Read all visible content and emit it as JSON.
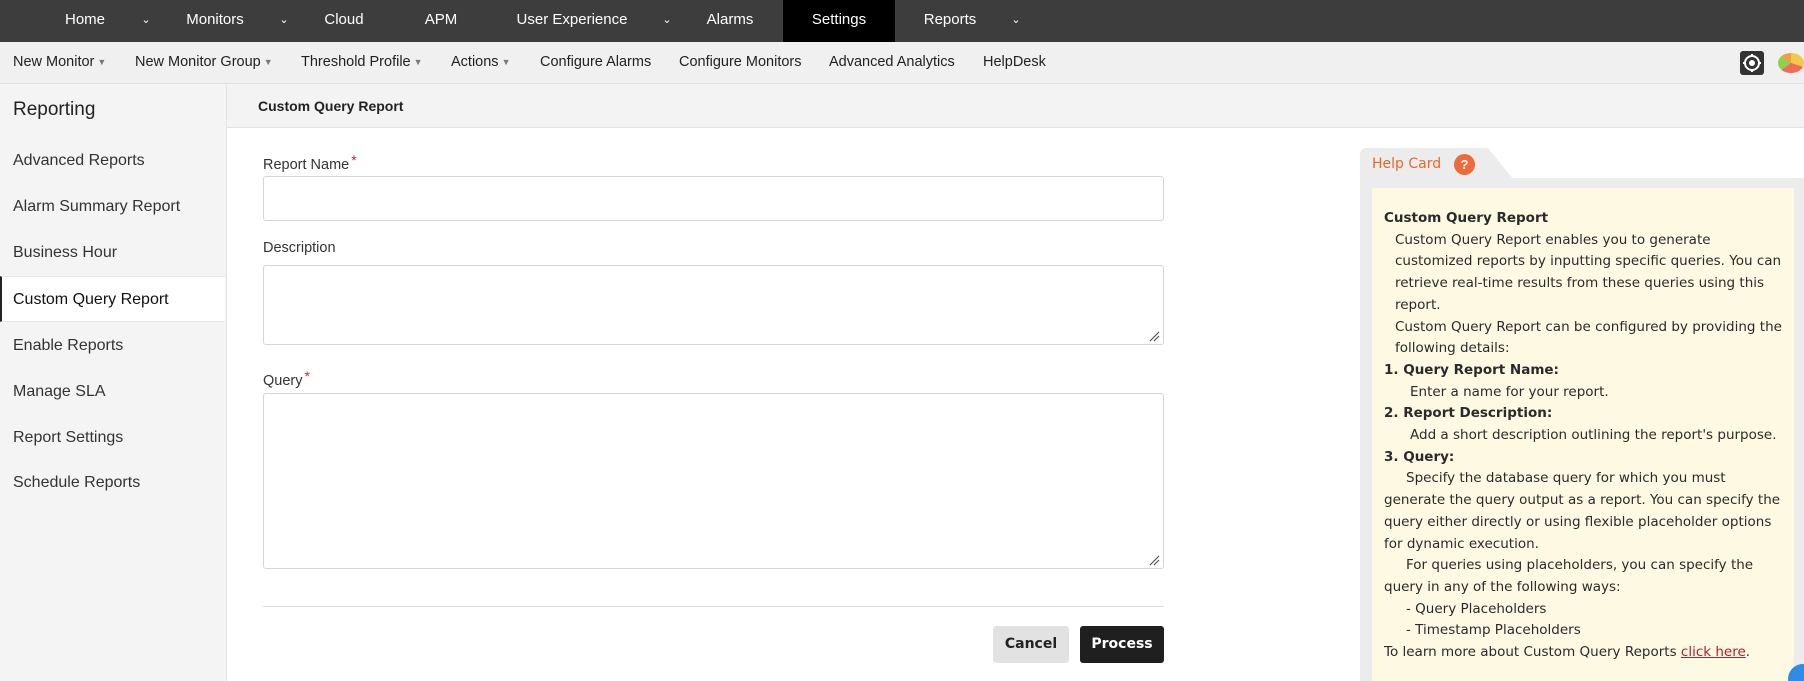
{
  "topnav": {
    "items": [
      {
        "label": "Home",
        "has_dropdown": true
      },
      {
        "label": "Monitors",
        "has_dropdown": true
      },
      {
        "label": "Cloud",
        "has_dropdown": false
      },
      {
        "label": "APM",
        "has_dropdown": false
      },
      {
        "label": "User Experience",
        "has_dropdown": true
      },
      {
        "label": "Alarms",
        "has_dropdown": false
      },
      {
        "label": "Settings",
        "has_dropdown": false,
        "active": true
      },
      {
        "label": "Reports",
        "has_dropdown": true
      }
    ]
  },
  "subnav": {
    "items": [
      {
        "label": "New Monitor",
        "has_dropdown": true
      },
      {
        "label": "New Monitor Group",
        "has_dropdown": true
      },
      {
        "label": "Threshold Profile",
        "has_dropdown": true
      },
      {
        "label": "Actions",
        "has_dropdown": true
      },
      {
        "label": "Configure Alarms",
        "has_dropdown": false
      },
      {
        "label": "Configure Monitors",
        "has_dropdown": false
      },
      {
        "label": "Advanced Analytics",
        "has_dropdown": false
      },
      {
        "label": "HelpDesk",
        "has_dropdown": false
      }
    ],
    "icons": [
      "settings-gear-icon",
      "pie-chart-icon"
    ]
  },
  "sidebar": {
    "title": "Reporting",
    "items": [
      {
        "label": "Advanced Reports"
      },
      {
        "label": "Alarm Summary Report"
      },
      {
        "label": "Business Hour"
      },
      {
        "label": "Custom Query Report",
        "active": true
      },
      {
        "label": "Enable Reports"
      },
      {
        "label": "Manage SLA"
      },
      {
        "label": "Report Settings"
      },
      {
        "label": "Schedule Reports"
      }
    ]
  },
  "main": {
    "title": "Custom Query Report",
    "form": {
      "report_name_label": "Report Name",
      "report_name_value": "",
      "description_label": "Description",
      "description_value": "",
      "query_label": "Query",
      "query_value": "",
      "required_marker": "*"
    },
    "buttons": {
      "cancel": "Cancel",
      "process": "Process"
    }
  },
  "help": {
    "tab_label": "Help Card",
    "tab_icon": "?",
    "heading": "Custom Query Report",
    "para1": "Custom Query Report enables you to generate customized reports by inputting specific queries. You can retrieve real-time results from these queries using this report.",
    "para2": "Custom Query Report can be configured by providing the following details:",
    "step1_title": "1. Query Report Name:",
    "step1_text": "Enter a name for your report.",
    "step2_title": "2. Report Description:",
    "step2_text": "Add a short description outlining the report's purpose.",
    "step3_title": "3. Query:",
    "step3_text": "Specify the database query for which you must generate the query output as a report. You can specify the query either directly or using flexible placeholder options for dynamic execution.",
    "step3_text2": "For queries using placeholders, you can specify the query in any of the following ways:",
    "option1": "- Query Placeholders",
    "option2": "- Timestamp Placeholders",
    "footer_text": "To learn more about Custom Query Reports ",
    "footer_link": "click here",
    "footer_end": "."
  },
  "colors": {
    "topnav_bg": "#3d3d3d",
    "active_tab": "#000000",
    "help_accent": "#e8662b",
    "help_bg": "#fdf9e2",
    "required": "#e02020",
    "link": "#b0202a"
  }
}
